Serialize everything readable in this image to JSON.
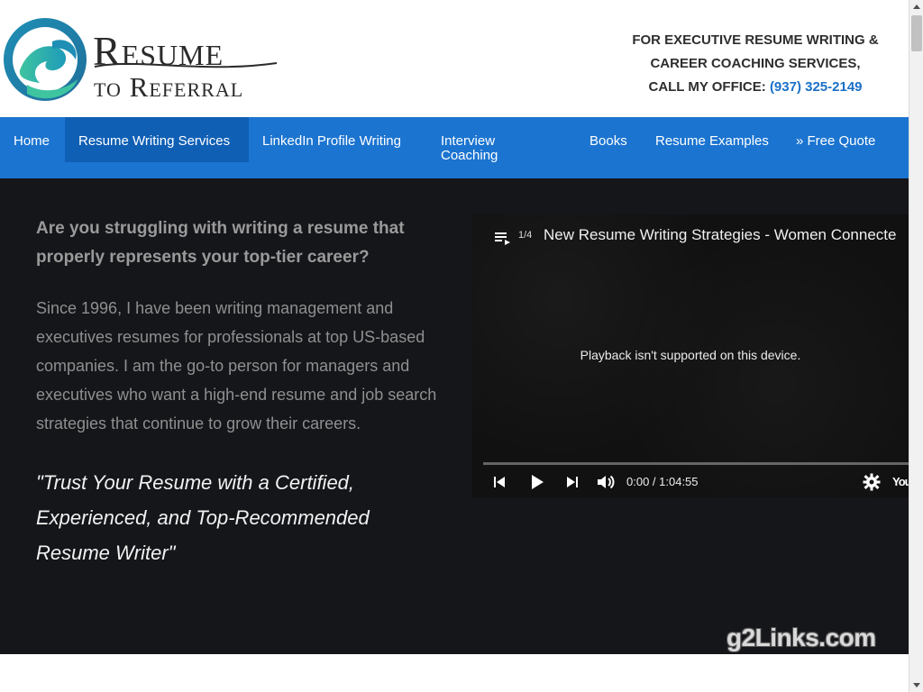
{
  "header": {
    "logo_line1": "Resume",
    "logo_line2": "to Referral",
    "contact_line1": "FOR EXECUTIVE RESUME WRITING &",
    "contact_line2": "CAREER COACHING SERVICES,",
    "contact_line3_prefix": "CALL MY OFFICE: ",
    "phone": "(937) 325-2149",
    "colors": {
      "accent": "#1a6fc7",
      "text": "#2e2e2e"
    }
  },
  "nav": {
    "bg_color": "#1b74d0",
    "items": [
      {
        "label": "Home"
      },
      {
        "label": "Resume Writing Services",
        "active": true
      },
      {
        "label": "LinkedIn Profile Writing"
      },
      {
        "label": "Interview Coaching"
      },
      {
        "label": "Books"
      },
      {
        "label": "Resume Examples"
      },
      {
        "label": "» Free Quote"
      }
    ]
  },
  "hero": {
    "bg_color": "#15161a",
    "question": "Are you struggling with writing a resume that properly represents your top-tier career?",
    "body": "Since 1996, I have been writing management and executives resumes for professionals at top US-based companies. I am the go-to person for managers and executives who want a high-end resume and job search strategies that continue to grow their careers.",
    "quote": "\"Trust Your Resume with a Certified, Experienced, and Top-Recommended Resume Writer\""
  },
  "video": {
    "playlist_count": "1/4",
    "title": "New Resume Writing Strategies - Women Connecte",
    "message": "Playback isn't supported on this device.",
    "time": "0:00 / 1:04:55",
    "progress": 0,
    "brand": "You"
  },
  "watermark": "g2Links.com"
}
